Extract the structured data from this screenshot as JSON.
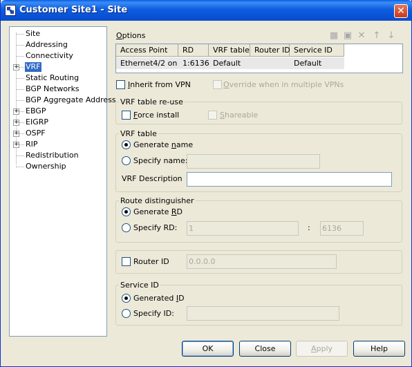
{
  "window": {
    "title": "Customer Site1 - Site",
    "close_glyph": "✕"
  },
  "nav": {
    "items": [
      {
        "label": "Site",
        "expandable": false
      },
      {
        "label": "Addressing",
        "expandable": false
      },
      {
        "label": "Connectivity",
        "expandable": false
      },
      {
        "label": "VRF",
        "expandable": true,
        "selected": true
      },
      {
        "label": "Static Routing",
        "expandable": false
      },
      {
        "label": "BGP Networks",
        "expandable": false
      },
      {
        "label": "BGP Aggregate Address",
        "expandable": false
      },
      {
        "label": "EBGP",
        "expandable": true
      },
      {
        "label": "EIGRP",
        "expandable": true
      },
      {
        "label": "OSPF",
        "expandable": true
      },
      {
        "label": "RIP",
        "expandable": true
      },
      {
        "label": "Redistribution",
        "expandable": false
      },
      {
        "label": "Ownership",
        "expandable": false
      }
    ],
    "expander_glyph": "+"
  },
  "options": {
    "label_mnemonic": "O",
    "label_rest": "ptions",
    "toolbar_icons": [
      "new-row-icon",
      "edit-icon",
      "delete-icon",
      "move-up-icon",
      "move-down-icon"
    ],
    "toolbar_glyphs": [
      "▦",
      "▣",
      "✕",
      "↑",
      "↓"
    ]
  },
  "grid": {
    "columns": [
      "Access Point",
      "RD",
      "VRF table",
      "Router ID",
      "Service ID"
    ],
    "rows": [
      [
        "Ethernet4/2 on ...",
        "1:6136",
        "Default",
        "",
        "Default"
      ]
    ]
  },
  "inherit_vpn": {
    "label_mnemonic": "I",
    "label_rest": "nherit from VPN",
    "checked": false
  },
  "override_vpns": {
    "label_mnemonic": "O",
    "label_rest": "verride when in multiple VPNs",
    "checked": false,
    "enabled": false
  },
  "vrf_reuse": {
    "title": "VRF table re-use",
    "force_install": {
      "label_mnemonic": "F",
      "label_rest": "orce install",
      "checked": false
    },
    "shareable": {
      "label_mnemonic": "S",
      "label_rest": "hareable",
      "checked": false,
      "enabled": false
    }
  },
  "vrf_table": {
    "title": "VRF table",
    "generate_name": {
      "label_pre": "Generate ",
      "label_mnemonic": "n",
      "label_post": "ame",
      "selected": true
    },
    "specify_name": {
      "label": "Specify name:",
      "value": ""
    },
    "description_label": "VRF Description",
    "description_value": ""
  },
  "route_distinguisher": {
    "title": "Route distinguisher",
    "generate_rd": {
      "label_pre": "Generate ",
      "label_mnemonic": "R",
      "label_post": "D",
      "selected": true
    },
    "specify_rd": {
      "label": "Specify RD:",
      "value_asn": "1",
      "separator": ":",
      "value_num": "6136"
    }
  },
  "router_id": {
    "label": "Router ID",
    "checked": false,
    "value": "0.0.0.0"
  },
  "service_id": {
    "title": "Service ID",
    "generated": {
      "label_pre": "Generated ",
      "label_mnemonic": "I",
      "label_post": "D",
      "selected": true
    },
    "specify": {
      "label": "Specify ID:",
      "value": ""
    }
  },
  "buttons": {
    "ok": "OK",
    "close": "Close",
    "apply_mnemonic": "A",
    "apply_rest": "pply",
    "help": "Help"
  }
}
